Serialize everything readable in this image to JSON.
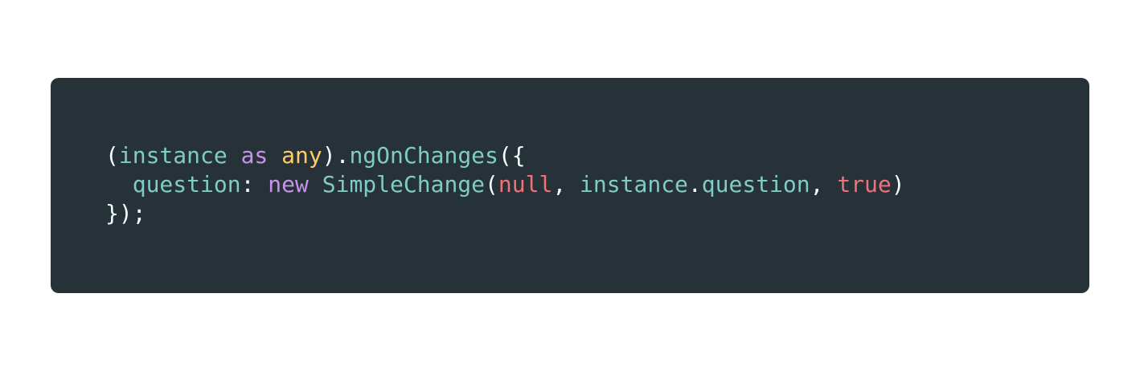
{
  "colors": {
    "background": "#ffffff",
    "code_background": "#263238",
    "identifier": "#80cbc4",
    "punctuation": "#eeffff",
    "keyword": "#c792ea",
    "type": "#ffcb6b",
    "literal": "#f07178"
  },
  "code": {
    "lines": [
      {
        "tokens": [
          {
            "text": "(",
            "kind": "punct"
          },
          {
            "text": "instance",
            "kind": "ident"
          },
          {
            "text": " ",
            "kind": "plain"
          },
          {
            "text": "as",
            "kind": "kw"
          },
          {
            "text": " ",
            "kind": "plain"
          },
          {
            "text": "any",
            "kind": "type"
          },
          {
            "text": ").",
            "kind": "punct"
          },
          {
            "text": "ngOnChanges",
            "kind": "ident"
          },
          {
            "text": "({",
            "kind": "punct"
          }
        ]
      },
      {
        "tokens": [
          {
            "text": "  ",
            "kind": "plain"
          },
          {
            "text": "question",
            "kind": "ident"
          },
          {
            "text": ": ",
            "kind": "punct"
          },
          {
            "text": "new",
            "kind": "kw"
          },
          {
            "text": " ",
            "kind": "plain"
          },
          {
            "text": "SimpleChange",
            "kind": "ident"
          },
          {
            "text": "(",
            "kind": "punct"
          },
          {
            "text": "null",
            "kind": "lit"
          },
          {
            "text": ", ",
            "kind": "punct"
          },
          {
            "text": "instance",
            "kind": "ident"
          },
          {
            "text": ".",
            "kind": "punct"
          },
          {
            "text": "question",
            "kind": "ident"
          },
          {
            "text": ", ",
            "kind": "punct"
          },
          {
            "text": "true",
            "kind": "lit"
          },
          {
            "text": ")",
            "kind": "punct"
          }
        ]
      },
      {
        "tokens": [
          {
            "text": "});",
            "kind": "punct"
          }
        ]
      }
    ]
  }
}
